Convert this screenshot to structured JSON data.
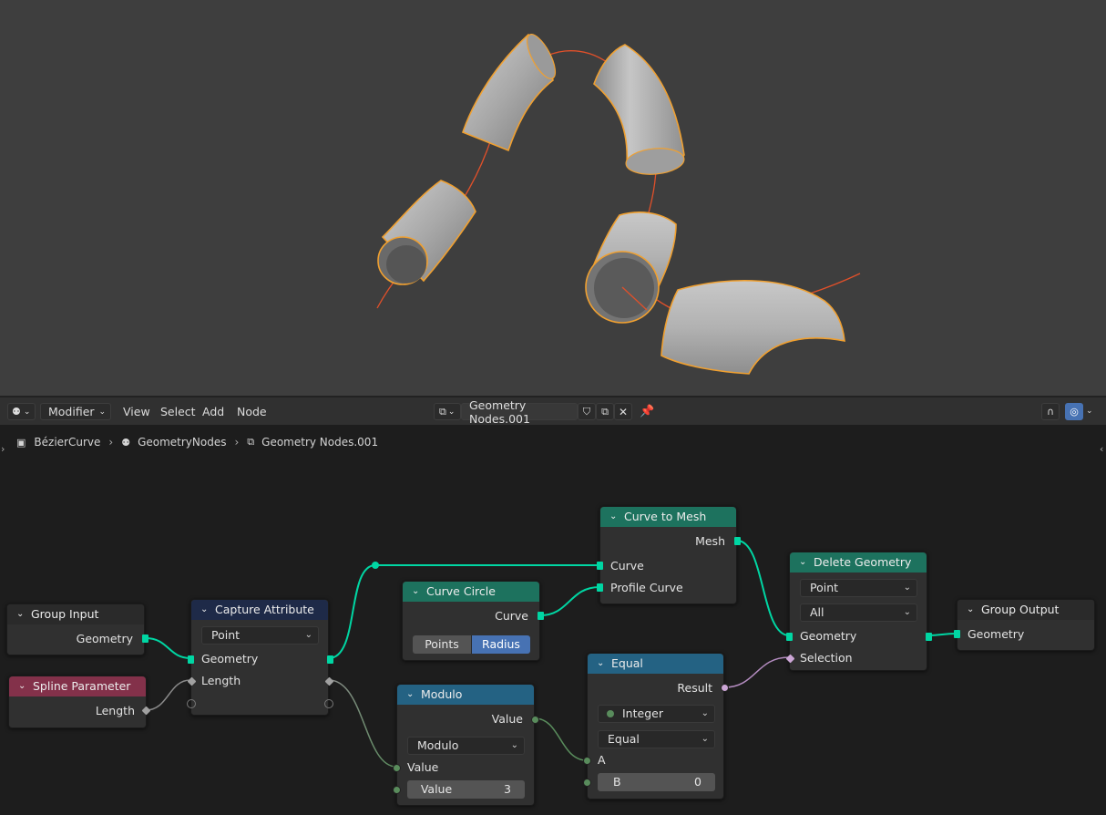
{
  "header": {
    "mode": "Modifier",
    "menus": [
      "View",
      "Select",
      "Add",
      "Node"
    ],
    "node_tree_name": "Geometry Nodes.001"
  },
  "breadcrumb": [
    "BézierCurve",
    "GeometryNodes",
    "Geometry Nodes.001"
  ],
  "nodes": {
    "group_input": {
      "title": "Group Input",
      "out_geometry": "Geometry"
    },
    "spline_parameter": {
      "title": "Spline Parameter",
      "out_length": "Length"
    },
    "capture_attribute": {
      "title": "Capture Attribute",
      "domain": "Point",
      "geometry": "Geometry",
      "length": "Length"
    },
    "curve_circle": {
      "title": "Curve Circle",
      "out_curve": "Curve",
      "mode_points": "Points",
      "mode_radius": "Radius"
    },
    "curve_to_mesh": {
      "title": "Curve to Mesh",
      "out_mesh": "Mesh",
      "in_curve": "Curve",
      "in_profile": "Profile Curve"
    },
    "modulo": {
      "title": "Modulo",
      "out_value": "Value",
      "operation": "Modulo",
      "in_value": "Value",
      "field_label": "Value",
      "field_value": "3"
    },
    "equal": {
      "title": "Equal",
      "out_result": "Result",
      "data_type": "Integer",
      "operation": "Equal",
      "in_a": "A",
      "b_label": "B",
      "b_value": "0"
    },
    "delete_geometry": {
      "title": "Delete Geometry",
      "domain": "Point",
      "mode": "All",
      "in_geometry": "Geometry",
      "in_selection": "Selection"
    },
    "group_output": {
      "title": "Group Output",
      "in_geometry": "Geometry"
    }
  },
  "colors": {
    "geometry_header": "#1d725e",
    "input_header": "#83314a",
    "attribute_header": "#1e2a48",
    "converter_header": "#246283",
    "group_header": "#2a2a2a",
    "geometry_socket": "#00d6a3",
    "int_socket": "#598c5c",
    "bool_socket": "#cca6d6",
    "selection_outline": "#f0a030"
  }
}
